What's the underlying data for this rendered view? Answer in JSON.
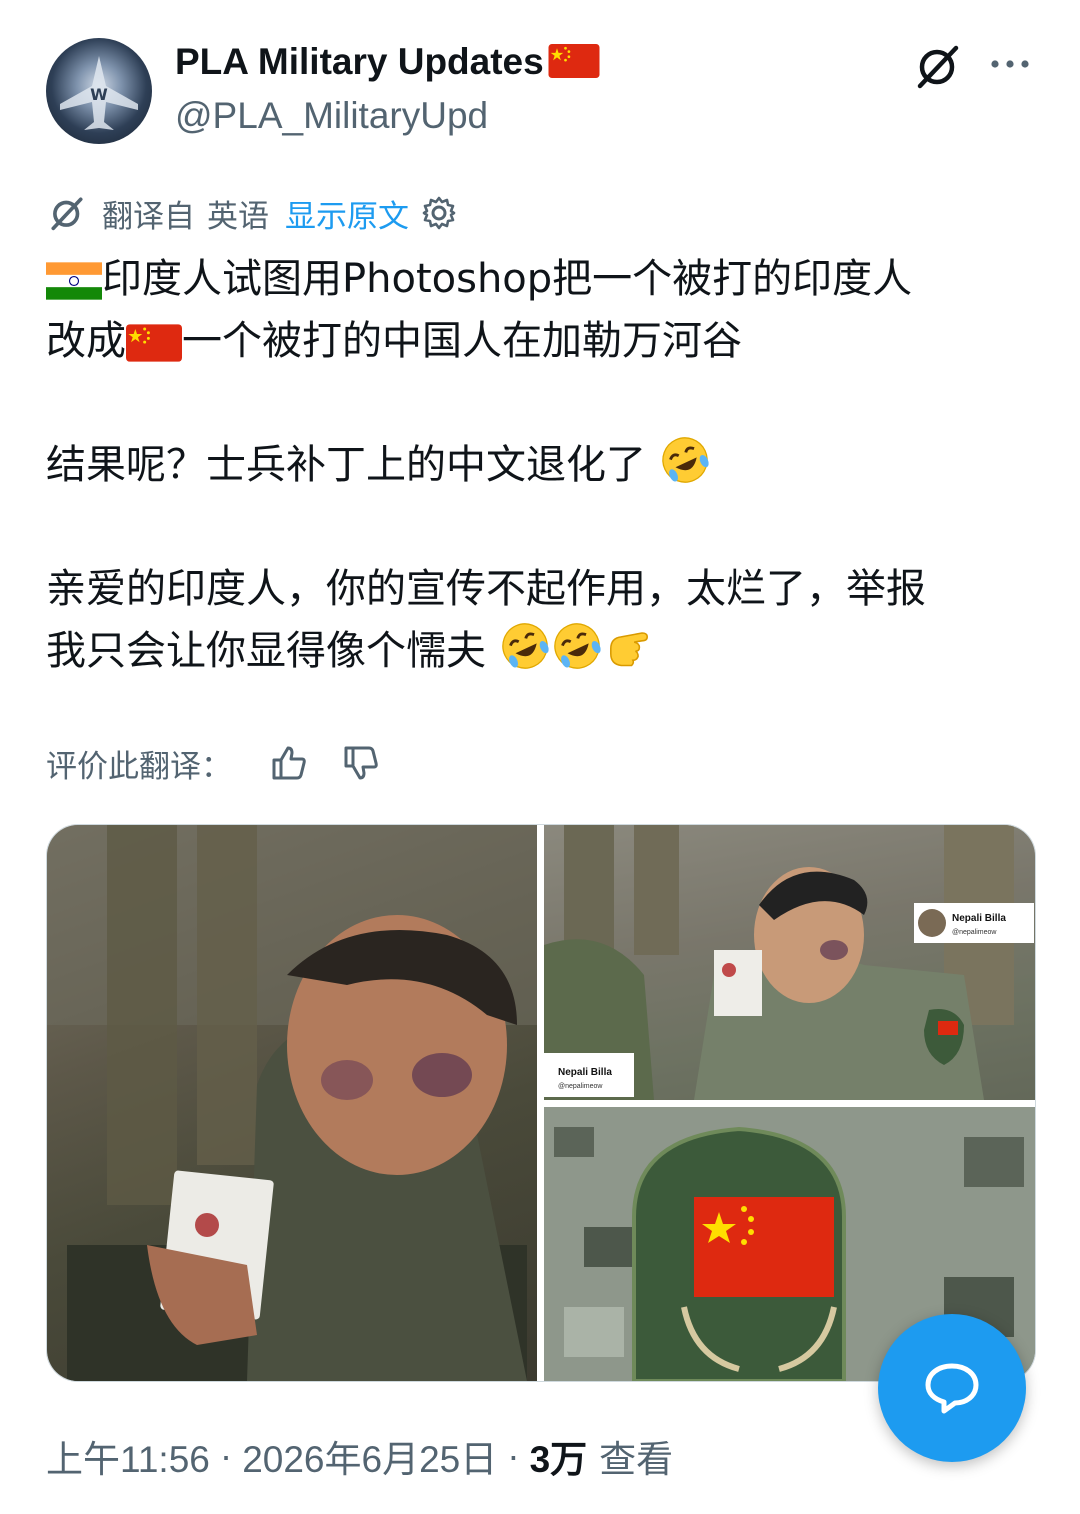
{
  "author": {
    "name": "PLA Military Updates",
    "handle": "@PLA_MilitaryUpd",
    "avatar_icon": "fighter-jet-avatar",
    "name_flag_icon": "china-flag-icon"
  },
  "header_actions": {
    "grok_icon": "grok-icon",
    "more_icon": "more-dots-icon"
  },
  "translation": {
    "label": "翻译自",
    "language": "英语",
    "show_original": "显示原文",
    "settings_icon": "gear-icon"
  },
  "tweet": {
    "line1_text": "印度人试图用Photoshop把一个被打的印度人",
    "line2_prefix": "改成",
    "line2_text": "一个被打的中国人在加勒万河谷",
    "para2": "结果呢？士兵补丁上的中文退化了",
    "para3_line1": "亲爱的印度人，你的宣传不起作用，太烂了，举报",
    "para3_line2": "我只会让你显得像个懦夫",
    "emoji_icons": [
      "india-flag-icon",
      "china-flag-icon",
      "rofl-emoji-icon",
      "rofl-emoji-icon",
      "rofl-emoji-icon",
      "pointing-hand-emoji-icon"
    ]
  },
  "rate_translation": {
    "label": "评价此翻译：",
    "up_icon": "thumbs-up-icon",
    "down_icon": "thumbs-down-icon"
  },
  "media": {
    "watermark_name": "Nepali Billa",
    "watermark_handle": "@nepalimeow"
  },
  "meta": {
    "time": "上午11:56",
    "separator": "·",
    "date": "2026年6月25日",
    "views_count": "3万",
    "views_label": "查看"
  },
  "fab": {
    "icon": "reply-bubble-icon"
  },
  "colors": {
    "accent": "#1d9bf0",
    "secondary_text": "#536471",
    "primary_text": "#0f1419"
  }
}
